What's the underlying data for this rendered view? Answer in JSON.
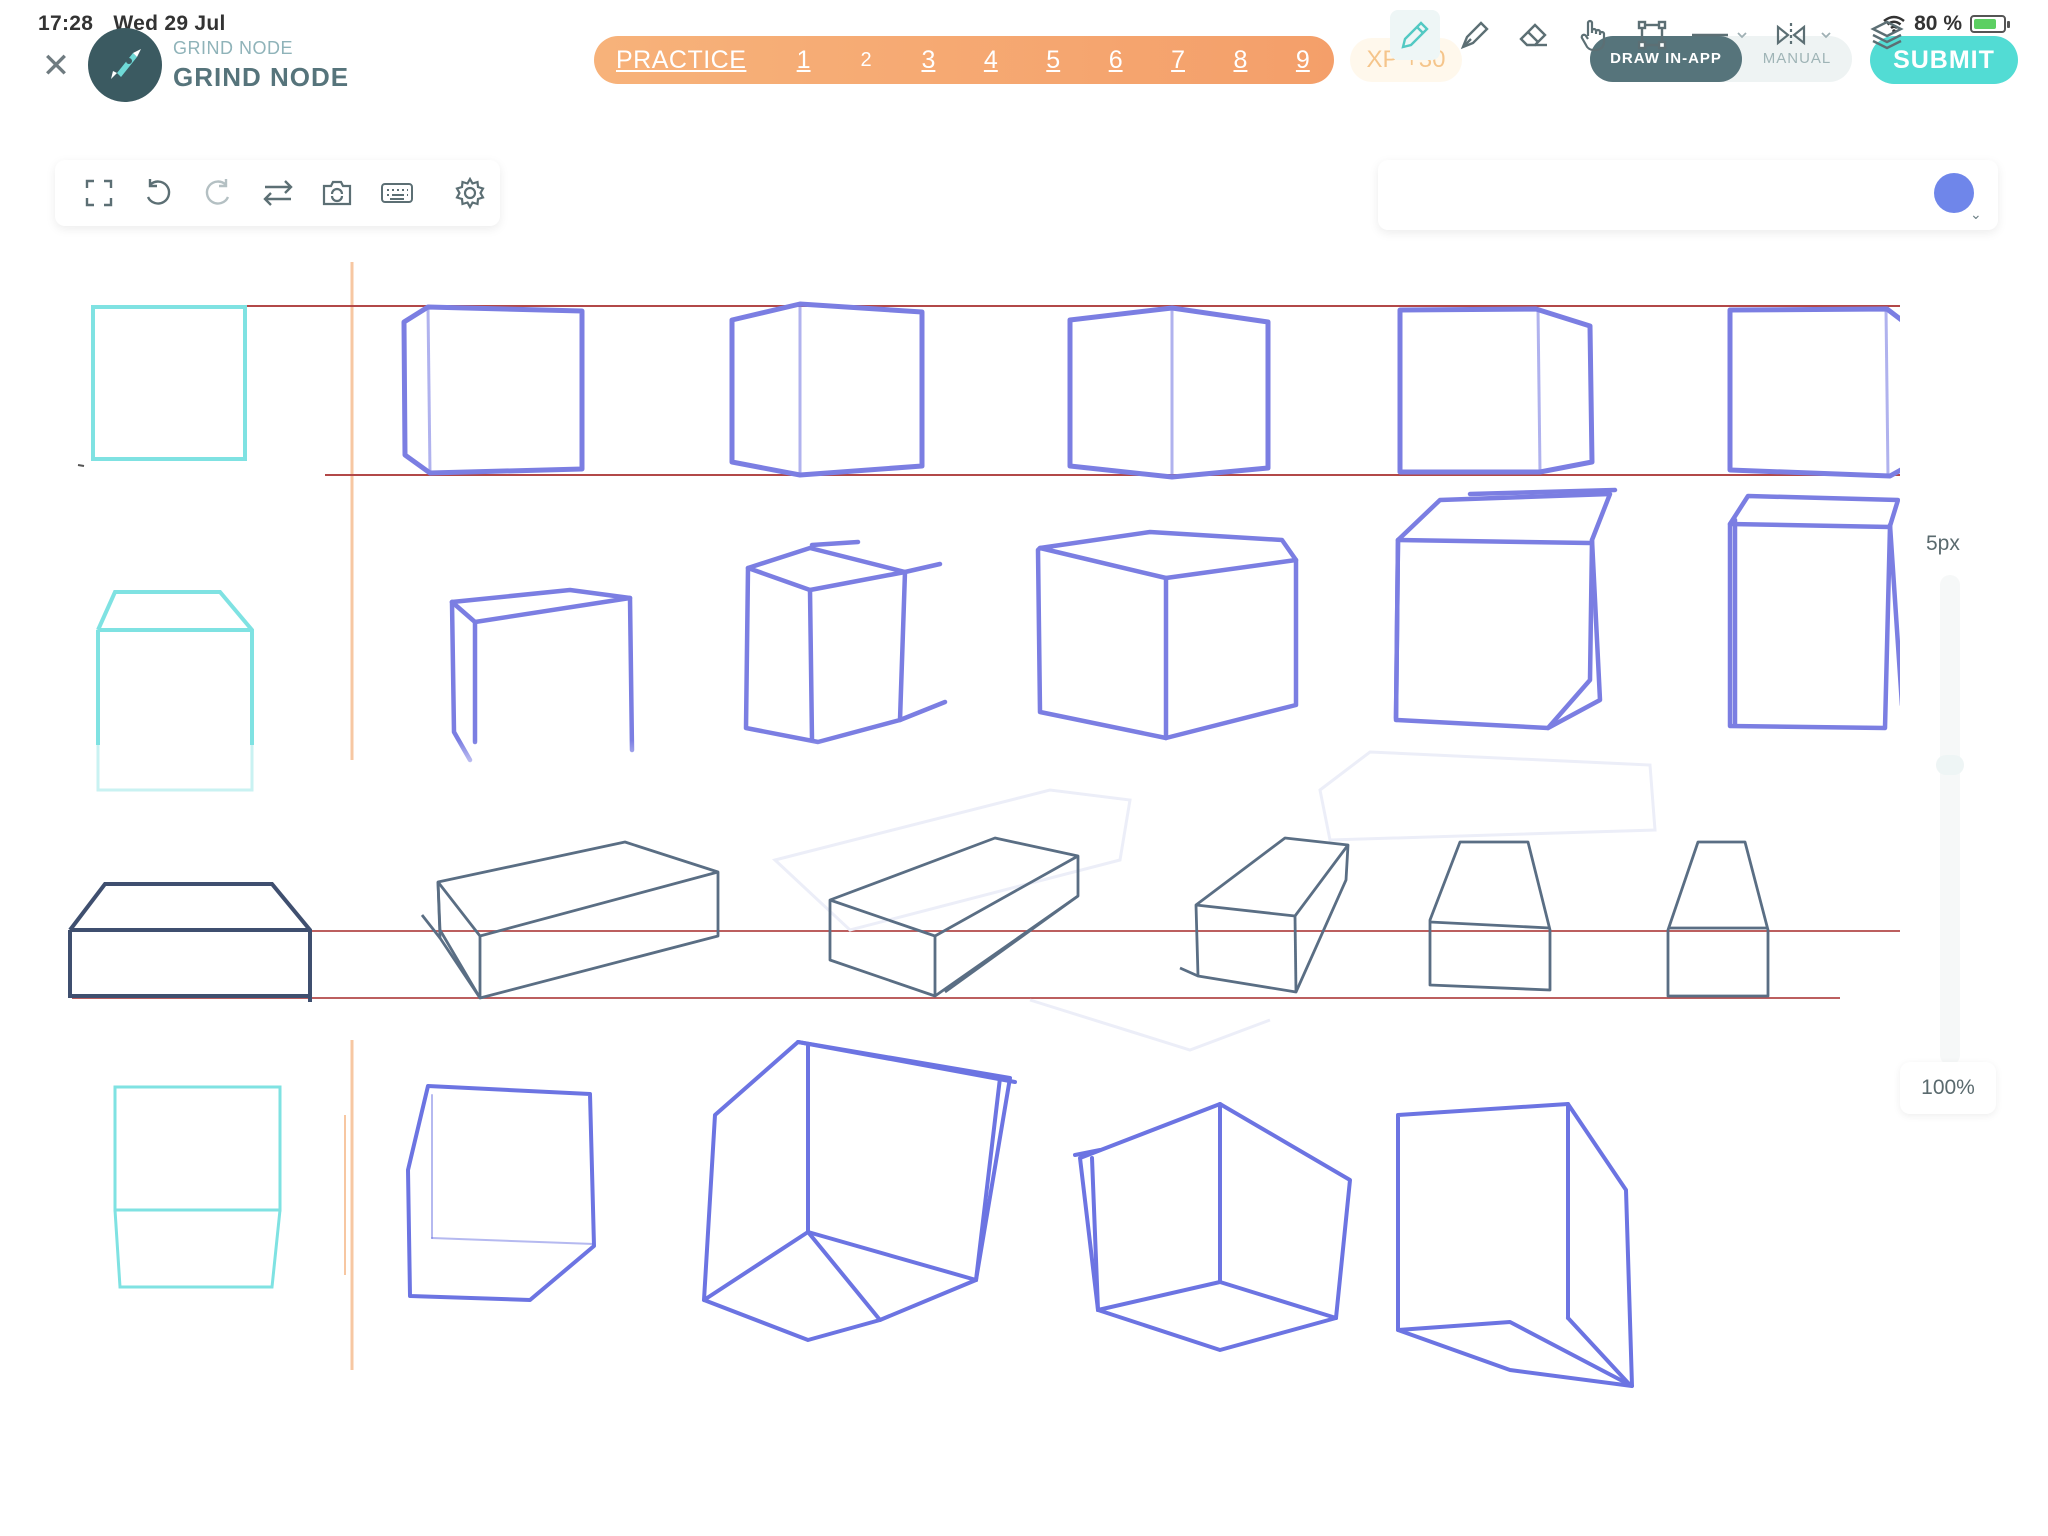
{
  "status_bar": {
    "time": "17:28",
    "date": "Wed 29 Jul",
    "battery": "80 %",
    "battery_level": 0.8
  },
  "header": {
    "brand_sub": "GRIND NODE",
    "brand_main": "GRIND NODE",
    "practice_label": "PRACTICE",
    "steps": [
      "1",
      "2",
      "3",
      "4",
      "5",
      "6",
      "7",
      "8",
      "9"
    ],
    "xp": "XP +30",
    "mode_active": "DRAW IN-APP",
    "mode_inactive": "MANUAL",
    "submit": "SUBMIT"
  },
  "toolbar_left_icons": [
    "fullscreen-icon",
    "undo-icon",
    "redo-icon",
    "swap-icon",
    "camera-flip-icon",
    "keyboard-icon",
    "settings-gear-icon"
  ],
  "toolbar_right_icons": [
    "pencil-icon",
    "pen-icon",
    "eraser-icon",
    "hand-icon",
    "rectangle-icon",
    "line-icon",
    "mirror-icon",
    "layers-icon"
  ],
  "colors": {
    "brush": "#6f86ea",
    "reference": "#7fe2e2",
    "reference_dark": "#3f4f6f",
    "guide_line": "#b24848",
    "accent": "#52dcd4",
    "practice": "#f5a56e"
  },
  "brush": {
    "size": "5px",
    "opacity": "100%"
  }
}
